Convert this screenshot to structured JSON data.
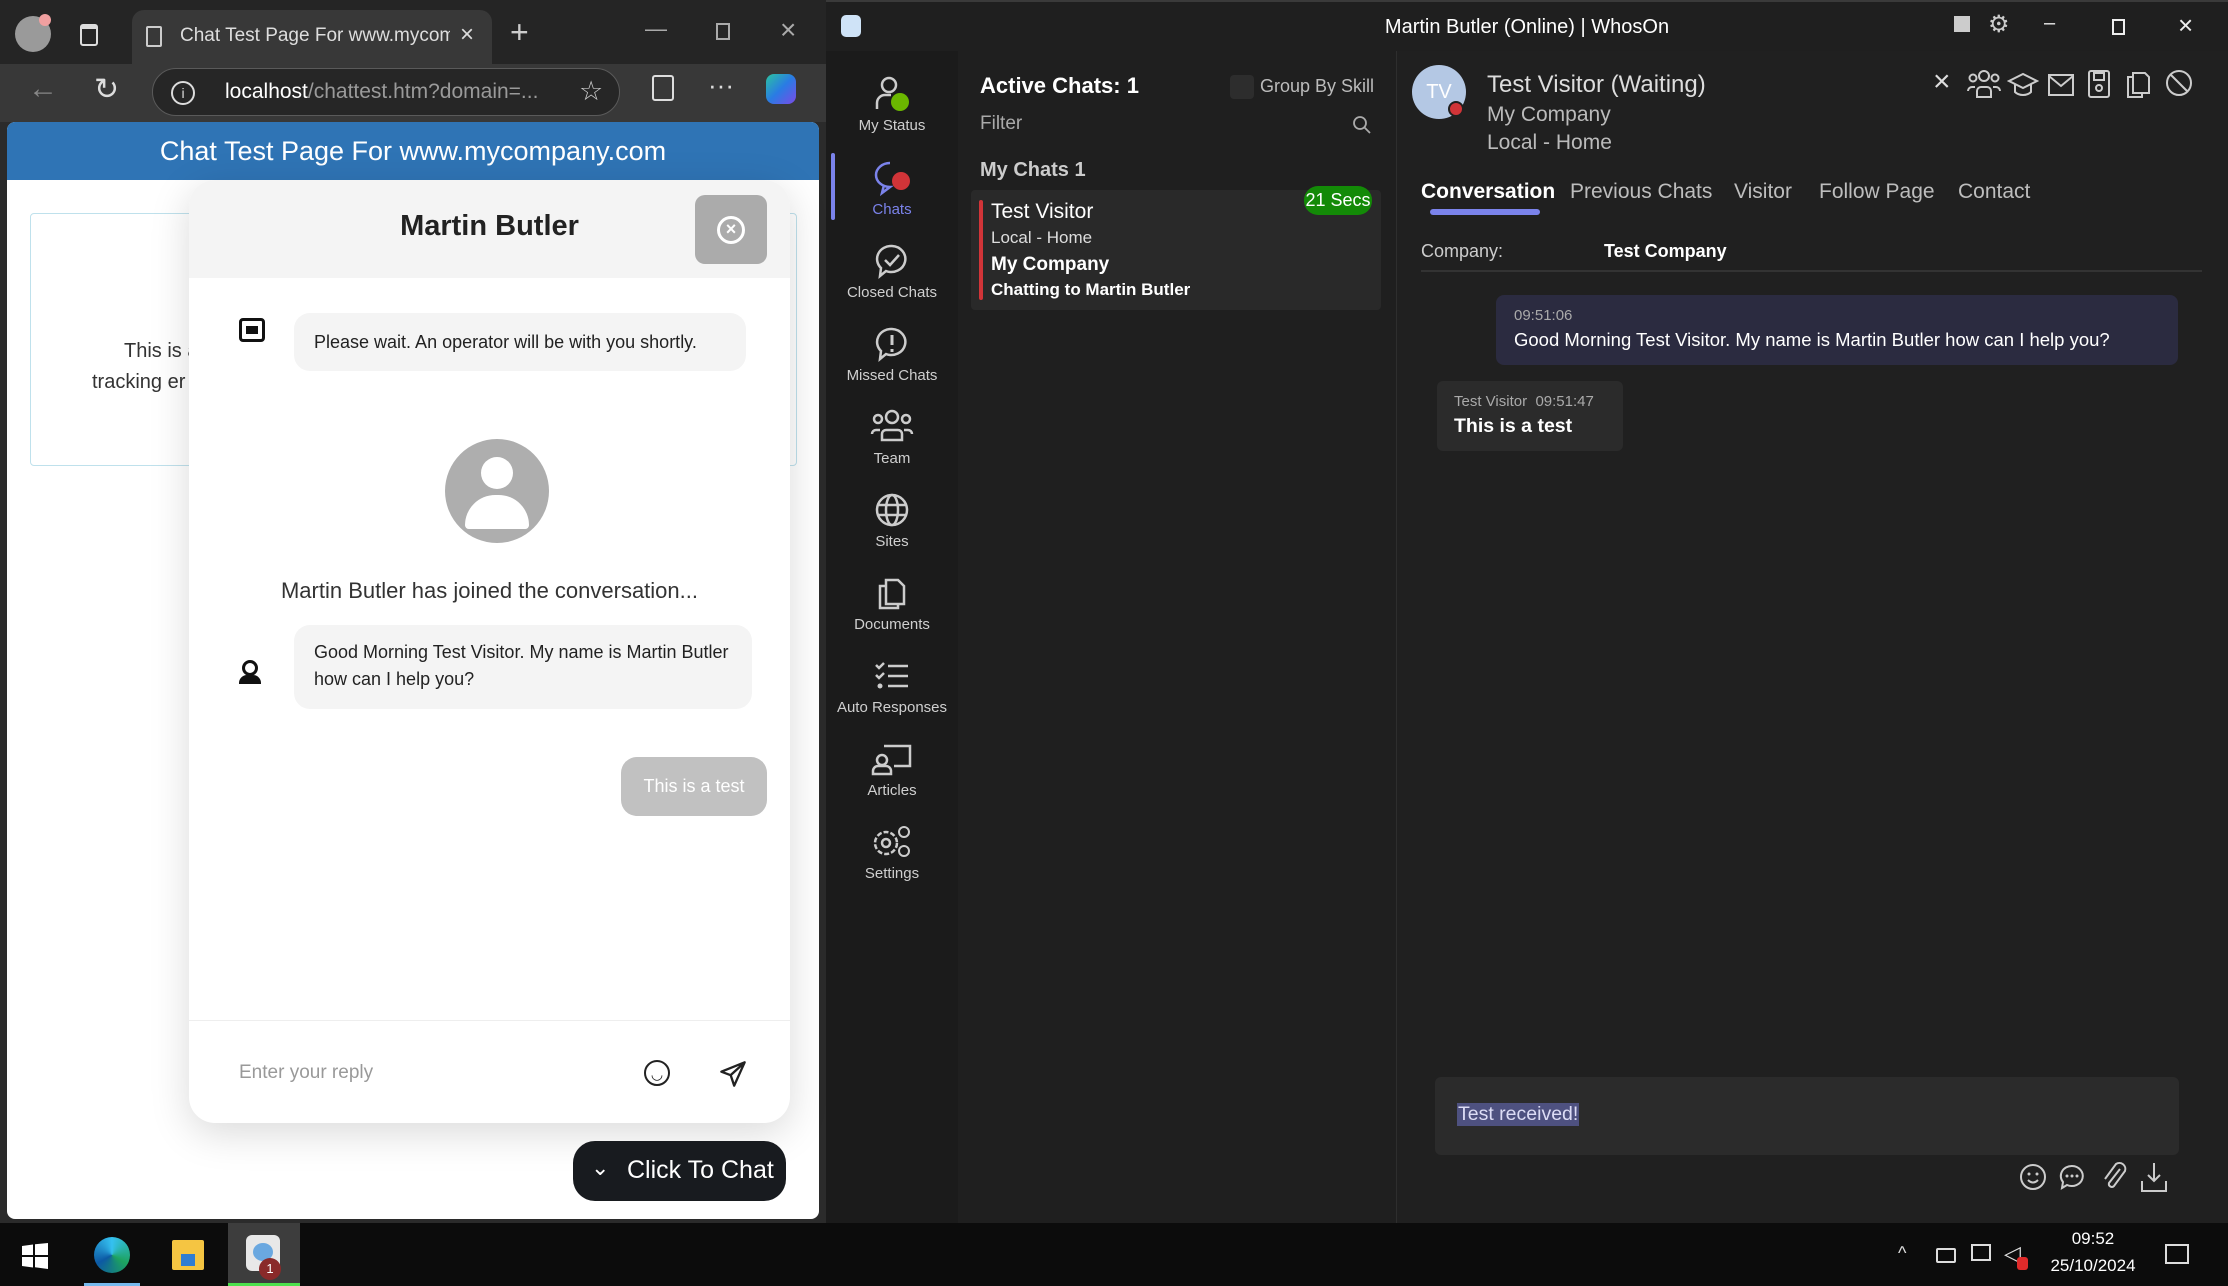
{
  "browser": {
    "tab_title": "Chat Test Page For www.mycomp",
    "address_host": "localhost",
    "address_path": "/chattest.htm?domain=...",
    "page_header": "Chat Test Page For www.mycompany.com",
    "page_text_line1": "This is a",
    "page_text_line2": "tracking er"
  },
  "widget": {
    "title": "Martin Butler",
    "messages": [
      {
        "sender": "bot",
        "text": "Please wait. An operator will be with you shortly."
      },
      {
        "sender": "operator",
        "text": "Good Morning Test Visitor. My name is Martin Butler how can I help you?"
      },
      {
        "sender": "visitor",
        "text": "This is a test"
      }
    ],
    "joined_text": "Martin Butler has joined the conversation...",
    "input_placeholder": "Enter your reply",
    "click_to_chat": "Click To Chat"
  },
  "app": {
    "title": "Martin Butler (Online)  | WhosOn",
    "nav": [
      {
        "label": "My Status",
        "icon": "status-icon"
      },
      {
        "label": "Chats",
        "icon": "chats-icon",
        "active": true
      },
      {
        "label": "Closed Chats",
        "icon": "closed-chats-icon"
      },
      {
        "label": "Missed Chats",
        "icon": "missed-chats-icon"
      },
      {
        "label": "Team",
        "icon": "team-icon"
      },
      {
        "label": "Sites",
        "icon": "globe-icon"
      },
      {
        "label": "Documents",
        "icon": "documents-icon"
      },
      {
        "label": "Auto Responses",
        "icon": "checklist-icon"
      },
      {
        "label": "Articles",
        "icon": "articles-icon"
      },
      {
        "label": "Settings",
        "icon": "settings-icon"
      }
    ],
    "chatlist": {
      "header": "Active Chats: 1",
      "group_by_skill": "Group By Skill",
      "filter_placeholder": "Filter",
      "section": "My Chats 1",
      "card": {
        "name": "Test Visitor",
        "location": "Local - Home",
        "company": "My Company",
        "status": "Chatting to Martin Butler",
        "timer": "21 Secs"
      }
    },
    "conversation": {
      "avatar_initials": "TV",
      "visitor_title": "Test Visitor (Waiting)",
      "company": "My Company",
      "location": "Local - Home",
      "tabs": [
        "Conversation",
        "Previous Chats",
        "Visitor",
        "Follow Page",
        "Contact"
      ],
      "active_tab": "Conversation",
      "company_label": "Company:",
      "company_value": "Test Company",
      "messages": [
        {
          "time": "09:51:06",
          "text": "Good Morning Test Visitor. My name is Martin Butler how can I help you?"
        },
        {
          "name": "Test Visitor",
          "time": "09:51:47",
          "text": "This is a test"
        }
      ],
      "reply_text": "Test received!"
    },
    "colors": {
      "accent": "#7b83eb",
      "timer_badge": "#138a07",
      "visitor_status": "#d13438"
    }
  },
  "taskbar": {
    "time": "09:52",
    "date": "25/10/2024",
    "whoson_badge": "1"
  }
}
